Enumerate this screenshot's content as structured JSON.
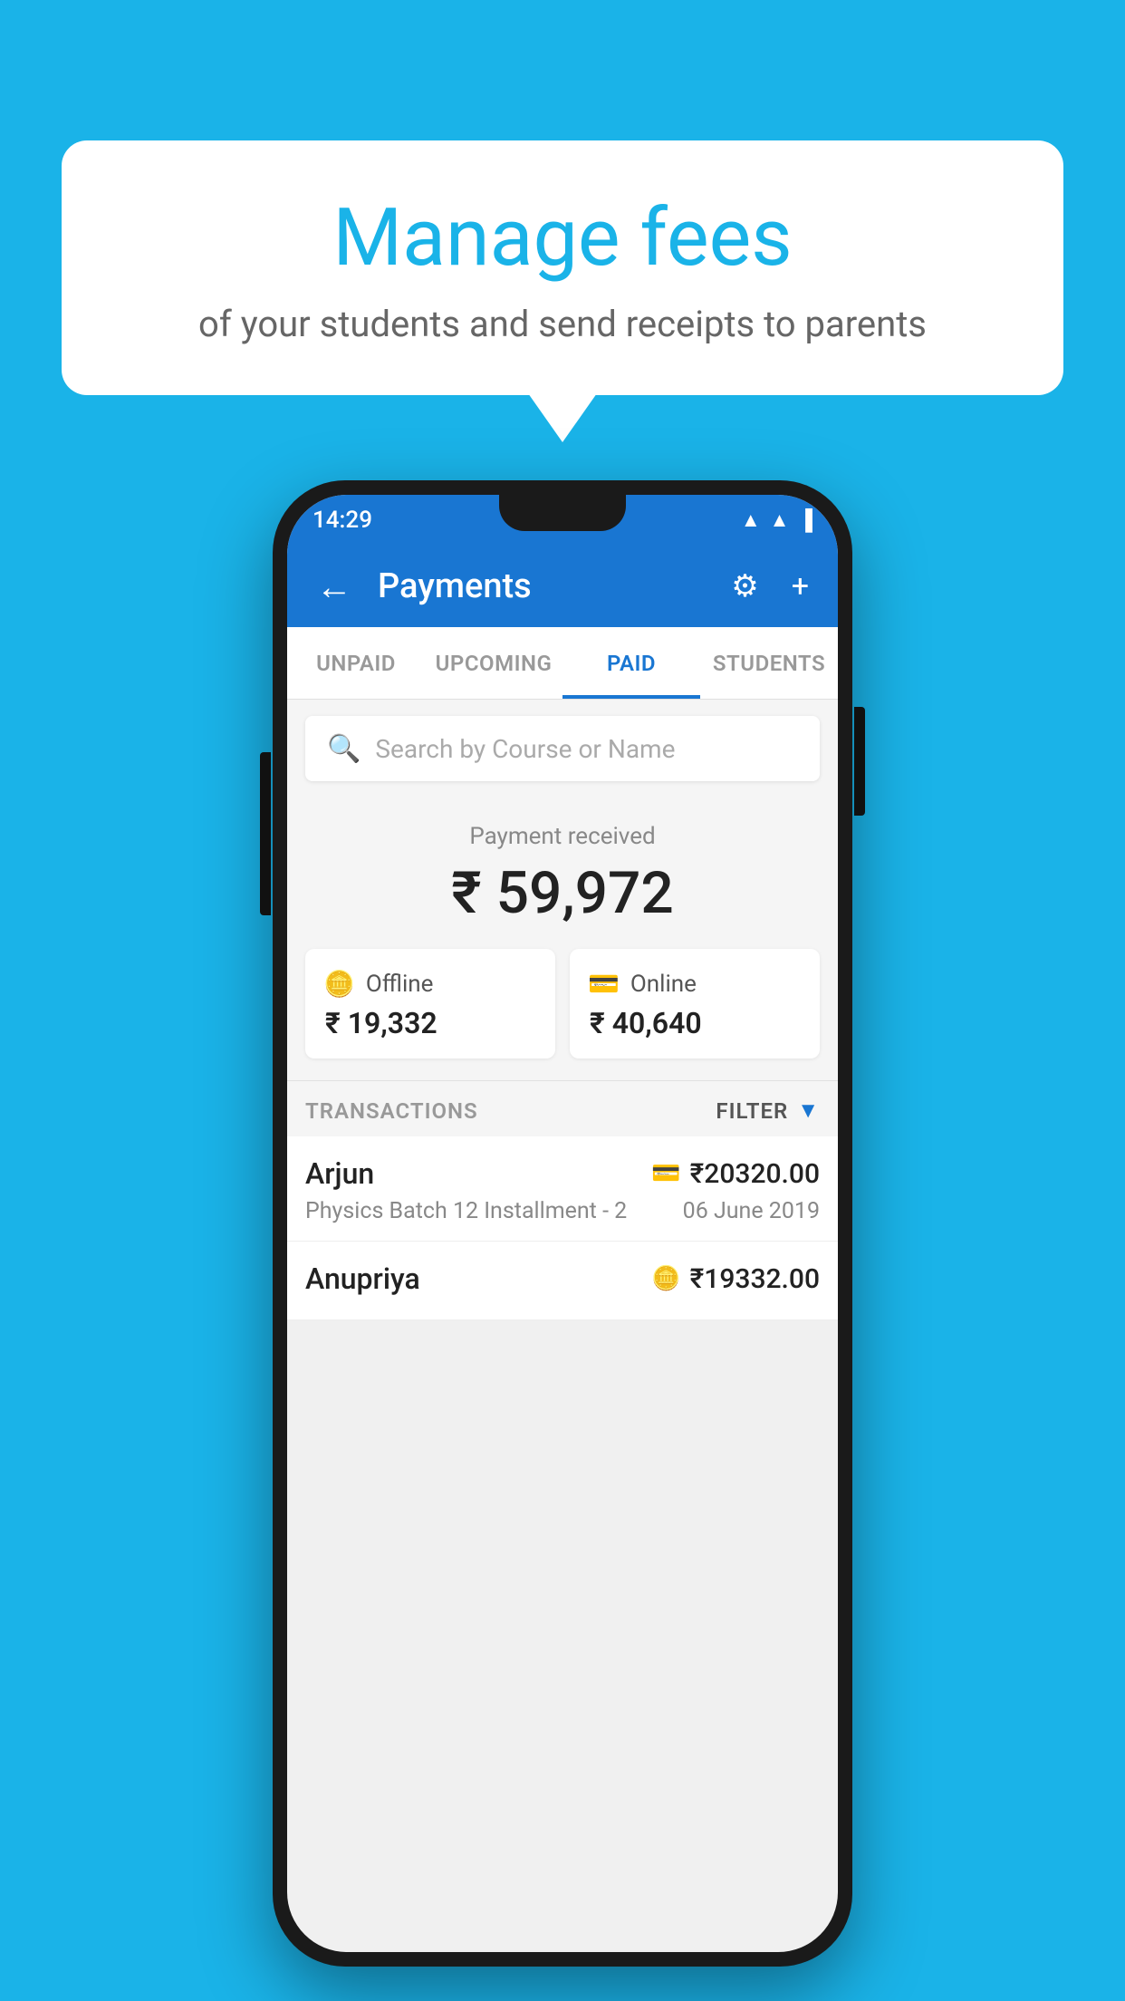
{
  "background_color": "#1ab3e8",
  "bubble": {
    "title": "Manage fees",
    "subtitle": "of your students and send receipts to parents"
  },
  "status_bar": {
    "time": "14:29",
    "wifi": "▲",
    "signal": "▲",
    "battery": "▐"
  },
  "top_bar": {
    "title": "Payments",
    "back_label": "←",
    "gear_label": "⚙",
    "plus_label": "+"
  },
  "tabs": [
    {
      "label": "UNPAID",
      "active": false
    },
    {
      "label": "UPCOMING",
      "active": false
    },
    {
      "label": "PAID",
      "active": true
    },
    {
      "label": "STUDENTS",
      "active": false
    }
  ],
  "search": {
    "placeholder": "Search by Course or Name"
  },
  "payment": {
    "label": "Payment received",
    "amount": "₹ 59,972"
  },
  "cards": [
    {
      "icon": "💳",
      "label": "Offline",
      "amount": "₹ 19,332"
    },
    {
      "icon": "💳",
      "label": "Online",
      "amount": "₹ 40,640"
    }
  ],
  "transactions_label": "TRANSACTIONS",
  "filter_label": "FILTER",
  "transactions": [
    {
      "name": "Arjun",
      "description": "Physics Batch 12 Installment - 2",
      "amount": "₹20320.00",
      "date": "06 June 2019",
      "type": "online"
    },
    {
      "name": "Anupriya",
      "description": "",
      "amount": "₹19332.00",
      "date": "",
      "type": "offline"
    }
  ]
}
